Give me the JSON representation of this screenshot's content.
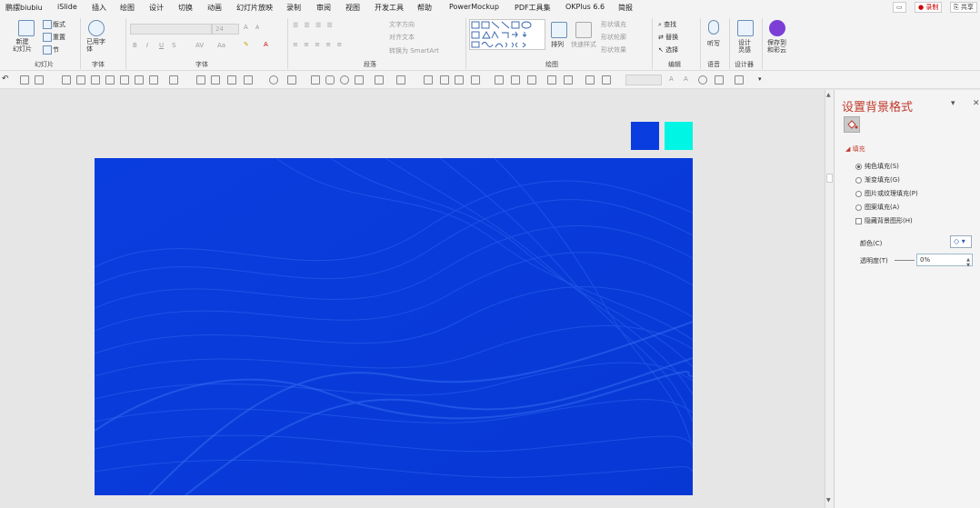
{
  "tabs": [
    "鹏摆biubiu",
    "iSlide",
    "插入",
    "绘图",
    "设计",
    "切换",
    "动画",
    "幻灯片放映",
    "录制",
    "审阅",
    "视图",
    "开发工具",
    "帮助",
    "PowerMockup",
    "PDF工具集",
    "OKPlus 6.6",
    "简报"
  ],
  "top_right": {
    "comment": "▭",
    "record": "● 录制",
    "share": "⎘ 共享"
  },
  "ribbon": {
    "slides": {
      "new_slide": "新建\n幻灯片",
      "layout": "版式",
      "reset": "重置",
      "section": "节",
      "label": "幻灯片"
    },
    "font_group": {
      "use_font": "已用字\n体",
      "label": "字体",
      "font_label": "字体",
      "size": "24",
      "bold": "B",
      "italic": "I",
      "underline": "U",
      "strike": "S",
      "spacing": "AV",
      "case": "Aa",
      "grow": "A",
      "shrink": "A"
    },
    "paragraph": {
      "text_dir": "文字方向",
      "align_text": "对齐文本",
      "smartart": "转换为 SmartArt",
      "label": "段落"
    },
    "drawing": {
      "arrange": "排列",
      "quick_styles": "快速样式",
      "shape_fill": "形状填充",
      "shape_outline": "形状轮廓",
      "shape_effects": "形状效果",
      "label": "绘图"
    },
    "editing": {
      "find": "查找",
      "replace": "替换",
      "select": "选择",
      "label": "编辑"
    },
    "voice": {
      "dictate": "听写",
      "label": "语音"
    },
    "designer": {
      "design_ideas": "设计\n灵感",
      "label": "设计器"
    },
    "cloud": {
      "save": "保存到\n和彩云"
    }
  },
  "swatches": {
    "blue": "#0a3ddf",
    "cyan": "#00f5e4"
  },
  "pane": {
    "title": "设置背景格式",
    "pin": "▾",
    "close": "✕",
    "section": "填充",
    "options": [
      {
        "label": "纯色填充(S)",
        "selected": true
      },
      {
        "label": "渐变填充(G)",
        "selected": false
      },
      {
        "label": "图片或纹理填充(P)",
        "selected": false
      },
      {
        "label": "图案填充(A)",
        "selected": false
      }
    ],
    "hide_bg": "隐藏背景图形(H)",
    "color_label": "颜色(C)",
    "color_btn": "◇ ▾",
    "transparency_label": "透明度(T)",
    "transparency_value": "0%"
  }
}
